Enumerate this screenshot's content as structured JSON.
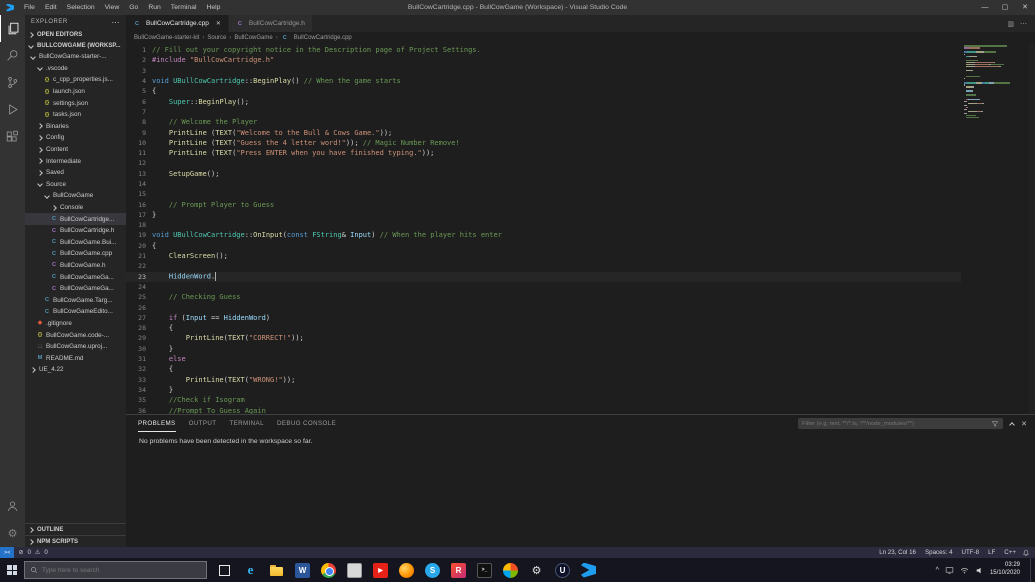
{
  "titlebar": {
    "menus": [
      "File",
      "Edit",
      "Selection",
      "View",
      "Go",
      "Run",
      "Terminal",
      "Help"
    ],
    "title": "BullCowCartridge.cpp - BullCowGame (Workspace) - Visual Studio Code"
  },
  "activitybar": {
    "top": [
      {
        "name": "explorer",
        "active": true
      },
      {
        "name": "search",
        "active": false
      },
      {
        "name": "source-control",
        "active": false
      },
      {
        "name": "run-debug",
        "active": false
      },
      {
        "name": "extensions",
        "active": false
      }
    ],
    "bottom": [
      {
        "name": "account"
      },
      {
        "name": "settings"
      }
    ]
  },
  "sidebar": {
    "title": "EXPLORER",
    "open_editors_label": "OPEN EDITORS",
    "workspace_label": "BULLCOWGAME (WORKSP...",
    "bottom_sections": [
      "OUTLINE",
      "NPM SCRIPTS"
    ],
    "tree": [
      {
        "l": "BullCowGame-starter-...",
        "i": 0,
        "k": "folder",
        "a": "v"
      },
      {
        "l": ".vscode",
        "i": 1,
        "k": "folder",
        "a": "v"
      },
      {
        "l": "c_cpp_properties.js...",
        "i": 2,
        "k": "file",
        "ic": "json"
      },
      {
        "l": "launch.json",
        "i": 2,
        "k": "file",
        "ic": "json"
      },
      {
        "l": "settings.json",
        "i": 2,
        "k": "file",
        "ic": "json"
      },
      {
        "l": "tasks.json",
        "i": 2,
        "k": "file",
        "ic": "json"
      },
      {
        "l": "Binaries",
        "i": 1,
        "k": "folder",
        "a": ">"
      },
      {
        "l": "Config",
        "i": 1,
        "k": "folder",
        "a": ">"
      },
      {
        "l": "Content",
        "i": 1,
        "k": "folder",
        "a": ">"
      },
      {
        "l": "Intermediate",
        "i": 1,
        "k": "folder",
        "a": ">"
      },
      {
        "l": "Saved",
        "i": 1,
        "k": "folder",
        "a": ">"
      },
      {
        "l": "Source",
        "i": 1,
        "k": "folder",
        "a": "v"
      },
      {
        "l": "BullCowGame",
        "i": 2,
        "k": "folder",
        "a": "v"
      },
      {
        "l": "Console",
        "i": 3,
        "k": "folder",
        "a": ">"
      },
      {
        "l": "BullCowCartridge...",
        "i": 3,
        "k": "file",
        "ic": "cpp",
        "sel": true
      },
      {
        "l": "BullCowCartridge.h",
        "i": 3,
        "k": "file",
        "ic": "h"
      },
      {
        "l": "BullCowGame.Bui...",
        "i": 3,
        "k": "file",
        "ic": "cs"
      },
      {
        "l": "BullCowGame.cpp",
        "i": 3,
        "k": "file",
        "ic": "cpp"
      },
      {
        "l": "BullCowGame.h",
        "i": 3,
        "k": "file",
        "ic": "h"
      },
      {
        "l": "BullCowGameGa...",
        "i": 3,
        "k": "file",
        "ic": "cpp"
      },
      {
        "l": "BullCowGameGa...",
        "i": 3,
        "k": "file",
        "ic": "h"
      },
      {
        "l": "BullCowGame.Targ...",
        "i": 2,
        "k": "file",
        "ic": "cs"
      },
      {
        "l": "BullCowGameEdito...",
        "i": 2,
        "k": "file",
        "ic": "cs"
      },
      {
        "l": ".gitignore",
        "i": 1,
        "k": "file",
        "ic": "git"
      },
      {
        "l": "BullCowGame.code-...",
        "i": 1,
        "k": "file",
        "ic": "json"
      },
      {
        "l": "BullCowGame.uproj...",
        "i": 1,
        "k": "file",
        "ic": "file"
      },
      {
        "l": "README.md",
        "i": 1,
        "k": "file",
        "ic": "md"
      },
      {
        "l": "UE_4.22",
        "i": 0,
        "k": "folder",
        "a": ">"
      }
    ]
  },
  "editor": {
    "tabs": [
      {
        "label": "BullCowCartridge.cpp",
        "icon": "cpp",
        "active": true
      },
      {
        "label": "BullCowCartridge.h",
        "icon": "h",
        "active": false
      }
    ],
    "breadcrumbs": [
      "BullCowGame-starter-kit",
      "Source",
      "BullCowGame",
      {
        "label": "BullCowCartridge.cpp",
        "icon": "cpp"
      }
    ],
    "cursor_line": 23,
    "lines": [
      [
        [
          "// Fill out your copyright notice in the Description page of Project Settings.",
          "com"
        ]
      ],
      [
        [
          "#include ",
          "kwc"
        ],
        [
          "\"BullCowCartridge.h\"",
          "str"
        ]
      ],
      [],
      [
        [
          "void ",
          "kw"
        ],
        [
          "UBullCowCartridge",
          "typ"
        ],
        [
          "::",
          "pln"
        ],
        [
          "BeginPlay",
          "fn"
        ],
        [
          "() ",
          "pln"
        ],
        [
          "// When the game starts",
          "com"
        ]
      ],
      [
        [
          "{",
          "pln"
        ]
      ],
      [
        [
          "    ",
          "pln"
        ],
        [
          "Super",
          "typ"
        ],
        [
          "::",
          "pln"
        ],
        [
          "BeginPlay",
          "fn"
        ],
        [
          "();",
          "pln"
        ]
      ],
      [],
      [
        [
          "    ",
          "pln"
        ],
        [
          "// Welcome the Player",
          "com"
        ]
      ],
      [
        [
          "    ",
          "pln"
        ],
        [
          "PrintLine",
          "fn"
        ],
        [
          " (",
          "pln"
        ],
        [
          "TEXT",
          "fn"
        ],
        [
          "(",
          "pln"
        ],
        [
          "\"Welcome to the Bull & Cows Game.\"",
          "str"
        ],
        [
          "));",
          "pln"
        ]
      ],
      [
        [
          "    ",
          "pln"
        ],
        [
          "PrintLine",
          "fn"
        ],
        [
          " (",
          "pln"
        ],
        [
          "TEXT",
          "fn"
        ],
        [
          "(",
          "pln"
        ],
        [
          "\"Guess the 4 letter word!\"",
          "str"
        ],
        [
          "));",
          "pln"
        ],
        [
          " ",
          "pln"
        ],
        [
          "// Magic Number Remove!",
          "com"
        ]
      ],
      [
        [
          "    ",
          "pln"
        ],
        [
          "PrintLine",
          "fn"
        ],
        [
          " (",
          "pln"
        ],
        [
          "TEXT",
          "fn"
        ],
        [
          "(",
          "pln"
        ],
        [
          "\"Press ENTER when you have finished typing.\"",
          "str"
        ],
        [
          "));",
          "pln"
        ]
      ],
      [],
      [
        [
          "    ",
          "pln"
        ],
        [
          "SetupGame",
          "fn"
        ],
        [
          "();",
          "pln"
        ]
      ],
      [],
      [],
      [
        [
          "    ",
          "pln"
        ],
        [
          "// Prompt Player to Guess",
          "com"
        ]
      ],
      [
        [
          "}",
          "pln"
        ]
      ],
      [],
      [
        [
          "void ",
          "kw"
        ],
        [
          "UBullCowCartridge",
          "typ"
        ],
        [
          "::",
          "pln"
        ],
        [
          "OnInput",
          "fn"
        ],
        [
          "(",
          "pln"
        ],
        [
          "const ",
          "kw"
        ],
        [
          "FString",
          "typ"
        ],
        [
          "& ",
          "pln"
        ],
        [
          "Input",
          "var"
        ],
        [
          ") ",
          "pln"
        ],
        [
          "// When the player hits enter",
          "com"
        ]
      ],
      [
        [
          "{",
          "pln"
        ]
      ],
      [
        [
          "    ",
          "pln"
        ],
        [
          "ClearScreen",
          "fn"
        ],
        [
          "();",
          "pln"
        ]
      ],
      [],
      [
        [
          "    ",
          "pln"
        ],
        [
          "HiddenWord",
          "var"
        ],
        [
          ".",
          "pln"
        ]
      ],
      [],
      [
        [
          "    ",
          "pln"
        ],
        [
          "// Checking Guess",
          "com"
        ]
      ],
      [],
      [
        [
          "    ",
          "pln"
        ],
        [
          "if ",
          "kwc"
        ],
        [
          "(",
          "pln"
        ],
        [
          "Input",
          "var"
        ],
        [
          " == ",
          "pln"
        ],
        [
          "HiddenWord",
          "var"
        ],
        [
          ")",
          "pln"
        ]
      ],
      [
        [
          "    {",
          "pln"
        ]
      ],
      [
        [
          "        ",
          "pln"
        ],
        [
          "PrintLine",
          "fn"
        ],
        [
          "(",
          "pln"
        ],
        [
          "TEXT",
          "fn"
        ],
        [
          "(",
          "pln"
        ],
        [
          "\"CORRECT!\"",
          "str"
        ],
        [
          "));",
          "pln"
        ]
      ],
      [
        [
          "    }",
          "pln"
        ]
      ],
      [
        [
          "    ",
          "pln"
        ],
        [
          "else",
          "kwc"
        ]
      ],
      [
        [
          "    {",
          "pln"
        ]
      ],
      [
        [
          "        ",
          "pln"
        ],
        [
          "PrintLine",
          "fn"
        ],
        [
          "(",
          "pln"
        ],
        [
          "TEXT",
          "fn"
        ],
        [
          "(",
          "pln"
        ],
        [
          "\"WRONG!\"",
          "str"
        ],
        [
          "));",
          "pln"
        ]
      ],
      [
        [
          "    }",
          "pln"
        ]
      ],
      [
        [
          "    ",
          "pln"
        ],
        [
          "//Check if Isogram",
          "com"
        ]
      ],
      [
        [
          "    ",
          "pln"
        ],
        [
          "//Prompt To Guess Again",
          "com"
        ]
      ]
    ]
  },
  "panel": {
    "tabs": [
      {
        "label": "PROBLEMS",
        "active": true
      },
      {
        "label": "OUTPUT",
        "active": false
      },
      {
        "label": "TERMINAL",
        "active": false
      },
      {
        "label": "DEBUG CONSOLE",
        "active": false
      }
    ],
    "filter_placeholder": "Filter (e.g. text, **/*.ts, !**/node_modules/**)",
    "message": "No problems have been detected in the workspace so far."
  },
  "statusbar": {
    "errors": "0",
    "warnings": "0",
    "items": [
      "Ln 23, Col 16",
      "Spaces: 4",
      "UTF-8",
      "LF",
      "C++"
    ]
  },
  "taskbar": {
    "search_placeholder": "Type here to search",
    "icons": [
      "task-view",
      "edge",
      "file-explorer",
      "word",
      "chrome",
      "media-app",
      "youtube",
      "firefox",
      "skype",
      "rider",
      "terminal",
      "photos",
      "settings",
      "unreal-engine",
      "vscode"
    ],
    "time": "03:29",
    "date": "15/10/2020"
  },
  "colors": {
    "comment": "#6A9955",
    "keyword": "#569CD6",
    "keyword_control": "#C586C0",
    "type": "#4EC9B0",
    "func": "#DCDCAA",
    "variable": "#9CDCFE",
    "string": "#CE9178",
    "plain": "#D4D4D4",
    "file_cpp": "#519aba",
    "file_h": "#a074c4",
    "file_json": "#cbcb41",
    "selection_bg": "#37373d",
    "editor_bg": "#1e1e1e",
    "sidebar_bg": "#252526",
    "statusbar_bg": "#2b2b3d"
  }
}
